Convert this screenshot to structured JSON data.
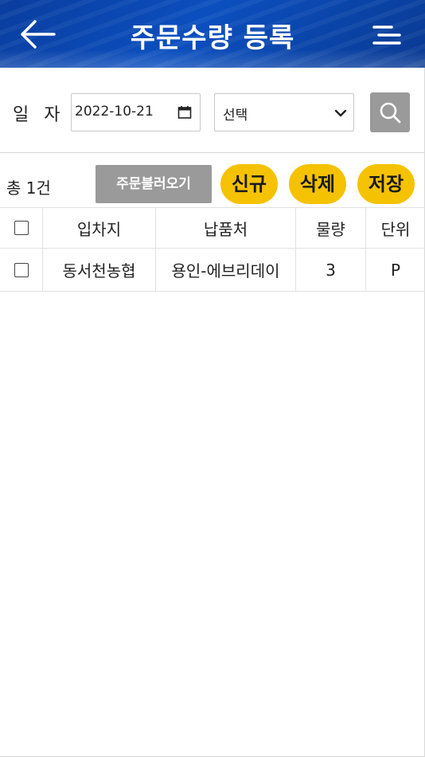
{
  "header": {
    "title": "주문수량 등록",
    "back_icon": "arrow-left-icon",
    "menu_icon": "menu-icon"
  },
  "filters": {
    "date_label": "일 자",
    "date_value": "2022-10-21",
    "select_value": "선택"
  },
  "actions": {
    "total_count": "총 1건",
    "load_orders_label": "주문불러오기",
    "new_label": "신규",
    "delete_label": "삭제",
    "save_label": "저장"
  },
  "table": {
    "columns": [
      "입차지",
      "납품처",
      "물량",
      "단위"
    ],
    "rows": [
      {
        "origin": "동서천농협",
        "destination": "용인-에브리데이",
        "quantity": "3",
        "unit": "P"
      }
    ]
  },
  "colors": {
    "header_blue": "#0b4fbf",
    "accent_yellow": "#f5c200",
    "button_gray": "#9a9a9a"
  }
}
